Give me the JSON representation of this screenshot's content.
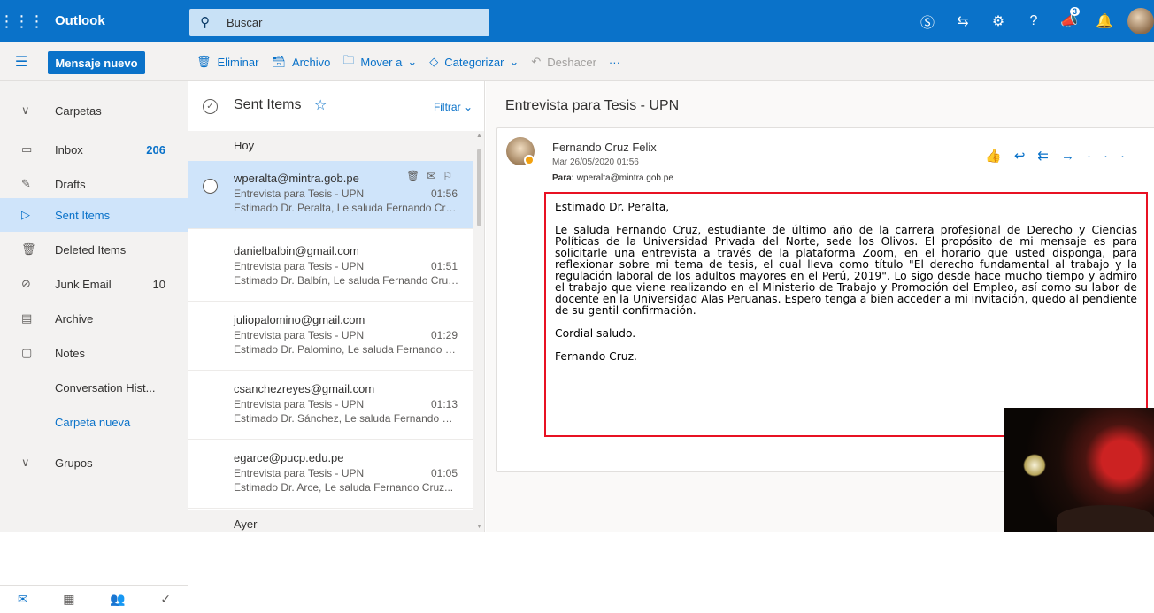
{
  "topbar": {
    "app_name": "Outlook",
    "search_placeholder": "Buscar",
    "notification_count": "3"
  },
  "toolbar": {
    "new_message": "Mensaje nuevo",
    "delete": "Eliminar",
    "archive": "Archivo",
    "move": "Mover a",
    "categorize": "Categorizar",
    "undo": "Deshacer",
    "more": "···"
  },
  "nav": {
    "folders_header": "Carpetas",
    "items": [
      {
        "label": "Inbox",
        "count": "206"
      },
      {
        "label": "Drafts",
        "count": ""
      },
      {
        "label": "Sent Items",
        "count": ""
      },
      {
        "label": "Deleted Items",
        "count": ""
      },
      {
        "label": "Junk Email",
        "count": "10"
      },
      {
        "label": "Archive",
        "count": ""
      },
      {
        "label": "Notes",
        "count": ""
      },
      {
        "label": "Conversation Hist...",
        "count": ""
      }
    ],
    "new_folder": "Carpeta nueva",
    "groups_header": "Grupos"
  },
  "list": {
    "title": "Sent Items",
    "filter": "Filtrar",
    "group_today": "Hoy",
    "group_yesterday": "Ayer",
    "messages": [
      {
        "from": "wperalta@mintra.gob.pe",
        "subject": "Entrevista para Tesis - UPN",
        "time": "01:56",
        "preview": "Estimado Dr. Peralta, Le saluda Fernando Cruz..."
      },
      {
        "from": "danielbalbin@gmail.com",
        "subject": "Entrevista para Tesis - UPN",
        "time": "01:51",
        "preview": "Estimado Dr. Balbín, Le saluda Fernando Cruz..."
      },
      {
        "from": "juliopalomino@gmail.com",
        "subject": "Entrevista para Tesis - UPN",
        "time": "01:29",
        "preview": "Estimado Dr. Palomino, Le saluda Fernando Cruz..."
      },
      {
        "from": "csanchezreyes@gmail.com",
        "subject": "Entrevista para Tesis - UPN",
        "time": "01:13",
        "preview": "Estimado Dr. Sánchez, Le saluda Fernando Cruz..."
      },
      {
        "from": "egarce@pucp.edu.pe",
        "subject": "Entrevista para Tesis - UPN",
        "time": "01:05",
        "preview": "Estimado Dr. Arce, Le saluda Fernando Cruz..."
      }
    ]
  },
  "reading": {
    "subject": "Entrevista para Tesis - UPN",
    "sender": "Fernando Cruz Felix",
    "date": "Mar 26/05/2020 01:56",
    "to_label": "Para:",
    "to_value": "wperalta@mintra.gob.pe",
    "body": {
      "greeting": "Estimado Dr. Peralta,",
      "paragraph": "Le saluda Fernando Cruz, estudiante de último año de la carrera profesional de Derecho y Ciencias Políticas de la Universidad Privada del Norte, sede los Olivos. El propósito de mi mensaje es para solicitarle una entrevista a través de la plataforma Zoom, en el horario que usted disponga, para reflexionar sobre mi tema de tesis, el cual lleva como título \"El derecho fundamental al trabajo y la regulación laboral de los adultos mayores en el Perú, 2019\". Lo sigo desde hace mucho tiempo y admiro el trabajo que viene realizando en el Ministerio de Trabajo y Promoción del Empleo, así como su labor de docente en la Universidad Alas Peruanas. Espero tenga a bien acceder a mi invitación, quedo al pendiente de su gentil confirmación.",
      "closing": "Cordial saludo.",
      "signature": "Fernando Cruz."
    }
  },
  "colors": {
    "brand": "#0a72c9",
    "selection": "#cfe4fa",
    "highlight_border": "#e81123"
  }
}
